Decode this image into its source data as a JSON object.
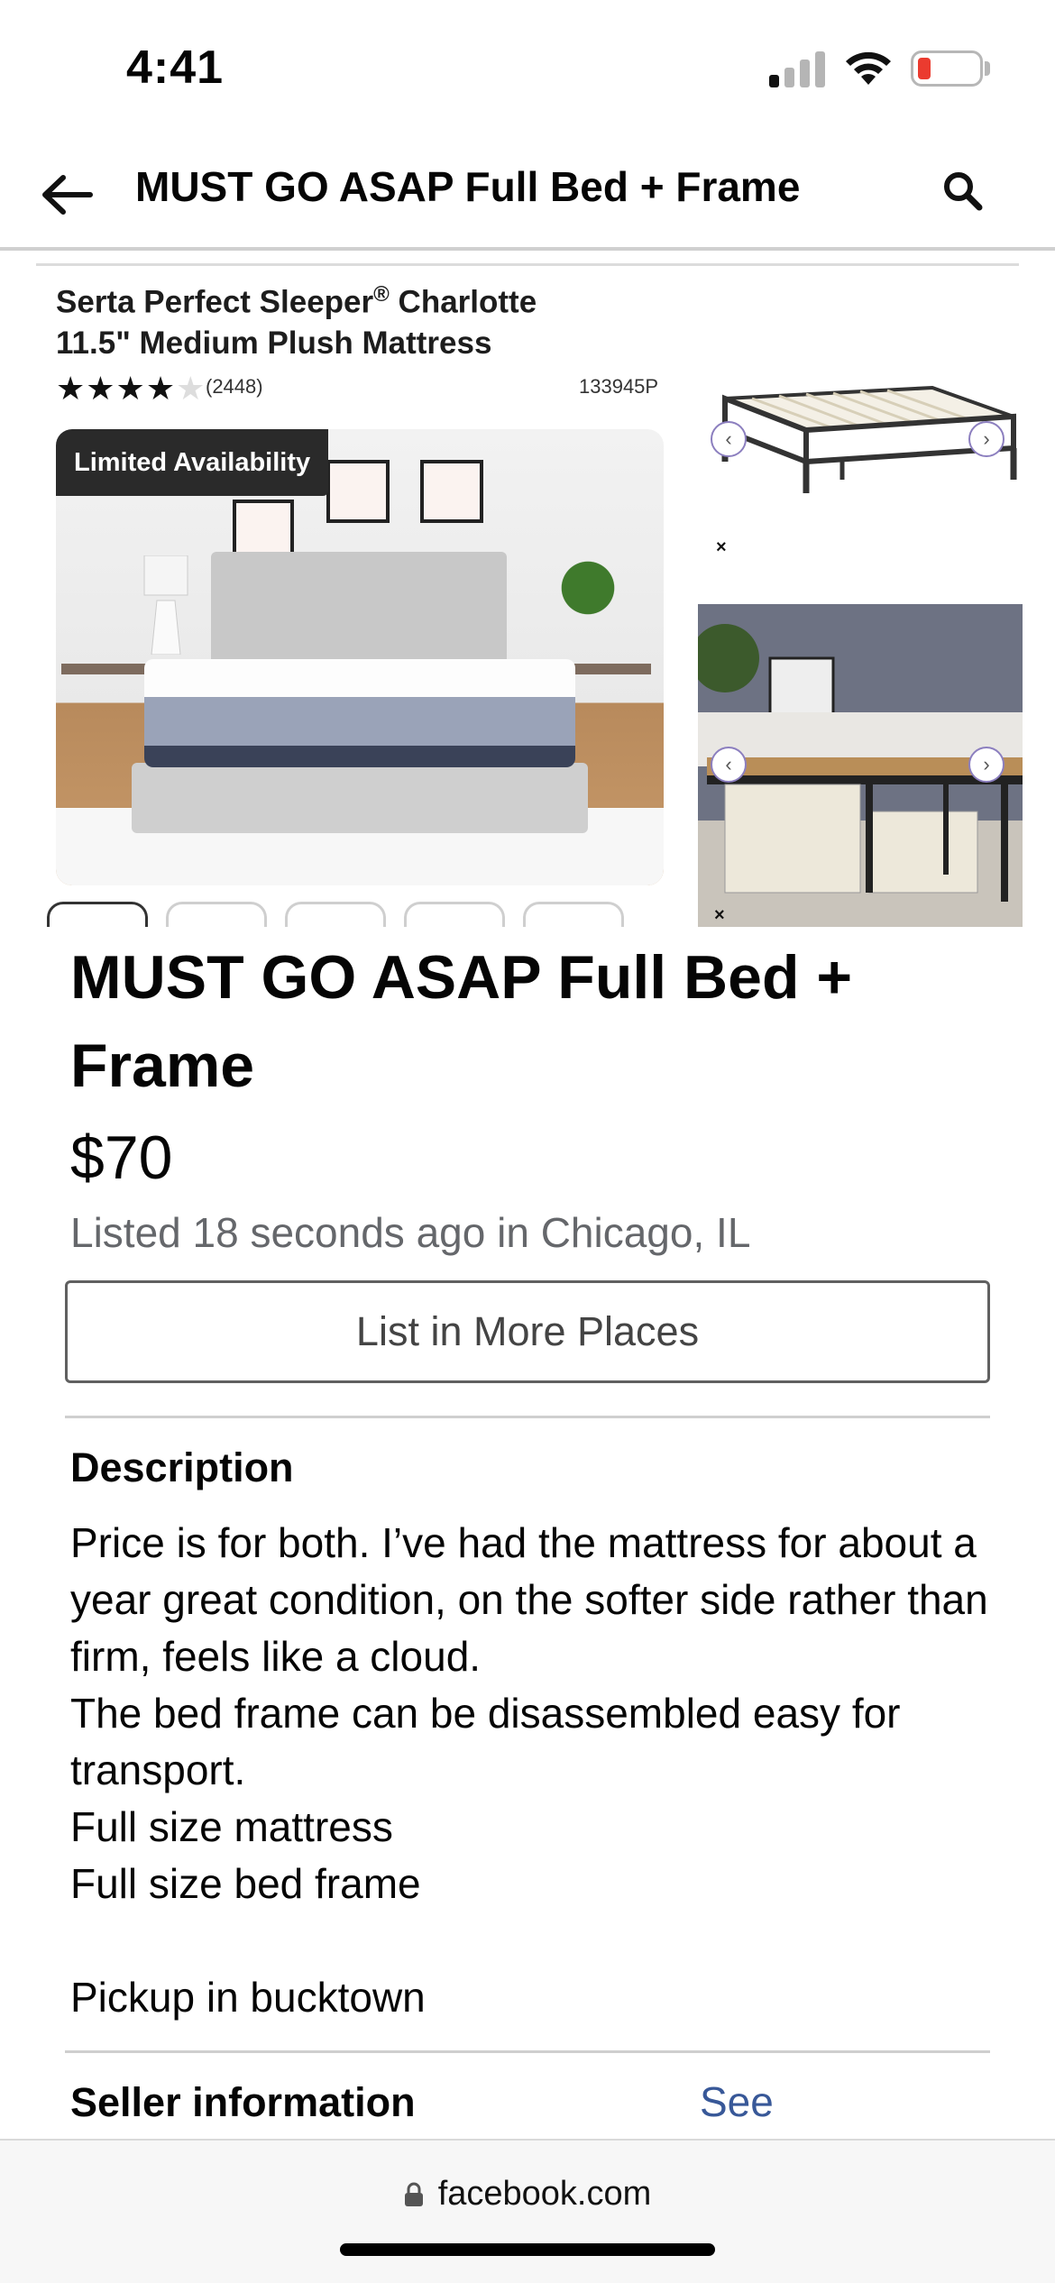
{
  "status_bar": {
    "time": "4:41"
  },
  "header": {
    "title": "MUST GO ASAP Full Bed + Frame"
  },
  "image": {
    "product_title_line1": "Serta Perfect Sleeper",
    "product_title_reg": "®",
    "product_title_line1b": " Charlotte",
    "product_title_line2": "11.5\" Medium Plush Mattress",
    "rating_stars_filled": 4,
    "rating_stars_total": 5,
    "review_count": "(2448)",
    "sku": "133945P",
    "badge": "Limited Availability"
  },
  "listing": {
    "title": "MUST GO ASAP Full Bed + Frame",
    "price": "$70",
    "listed": "Listed 18 seconds ago in Chicago, IL",
    "list_more_button": "List in More Places"
  },
  "description": {
    "heading": "Description",
    "lines": [
      "Price is for both. I’ve had the mattress for about a year great condition, on the softer side rather than firm, feels like a cloud.",
      "The bed frame can be disassembled easy for transport.",
      "Full size mattress",
      "Full size bed frame",
      "",
      "Pickup in bucktown"
    ]
  },
  "seller": {
    "heading": "Seller information",
    "see_link": "See"
  },
  "browser": {
    "url": "facebook.com"
  },
  "colors": {
    "link": "#385898",
    "secondary_text": "#65676b",
    "battery_low": "#eb3b2f"
  }
}
